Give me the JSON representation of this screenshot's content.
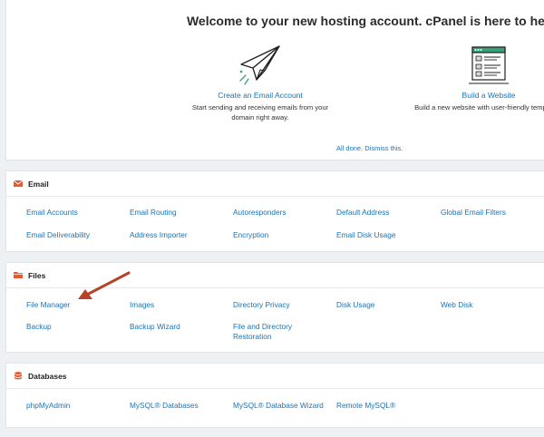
{
  "welcome": {
    "title": "Welcome to your new hosting account. cPanel is here to help!",
    "email_feature": {
      "link": "Create an Email Account",
      "desc": "Start sending and receiving emails from your domain right away."
    },
    "website_feature": {
      "link": "Build a Website",
      "desc": "Build a new website with user-friendly templates."
    },
    "dismiss": "All done. Dismiss this."
  },
  "sections": {
    "email": {
      "title": "Email",
      "items": [
        "Email Accounts",
        "Email Routing",
        "Autoresponders",
        "Default Address",
        "Global Email Filters",
        "Email Deliverability",
        "Address Importer",
        "Encryption",
        "Email Disk Usage"
      ]
    },
    "files": {
      "title": "Files",
      "items": [
        "File Manager",
        "Images",
        "Directory Privacy",
        "Disk Usage",
        "Web Disk",
        "Backup",
        "Backup Wizard",
        "File and Directory Restoration"
      ]
    },
    "databases": {
      "title": "Databases",
      "items": [
        "phpMyAdmin",
        "MySQL® Databases",
        "MySQL® Database Wizard",
        "Remote MySQL®"
      ]
    }
  },
  "colors": {
    "link": "#1a73b5",
    "icon_accent": "#e8592c",
    "arrow": "#b5432a"
  },
  "icons": {
    "email_feature": "paper-plane-icon",
    "website_feature": "website-template-icon",
    "email_section": "envelope-icon",
    "files_section": "folder-icon",
    "databases_section": "database-icon"
  }
}
